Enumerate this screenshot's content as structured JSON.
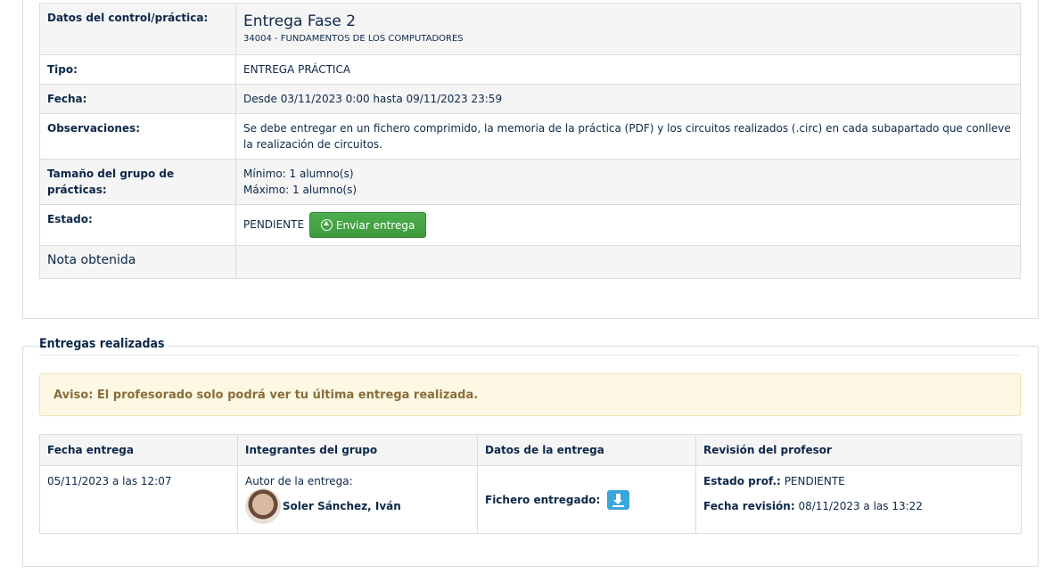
{
  "detail": {
    "control_label": "Datos del control/práctica:",
    "control_title": "Entrega Fase 2",
    "control_course": "34004 - FUNDAMENTOS DE LOS COMPUTADORES",
    "tipo_label": "Tipo:",
    "tipo_value": "ENTREGA PRÁCTICA",
    "fecha_label": "Fecha:",
    "fecha_value": "Desde 03/11/2023 0:00 hasta 09/11/2023 23:59",
    "obs_label": "Observaciones:",
    "obs_value": "Se debe entregar en un fichero comprimido, la memoria de la práctica (PDF) y los circuitos realizados (.circ) en cada subapartado que conlleve la realización de circuitos.",
    "group_label": "Tamaño del grupo de prácticas:",
    "group_min": "Mínimo: 1 alumno(s)",
    "group_max": "Máximo: 1 alumno(s)",
    "estado_label": "Estado:",
    "estado_value": "PENDIENTE",
    "send_button": "Enviar entrega",
    "nota_label": "Nota obtenida",
    "nota_value": ""
  },
  "deliveries": {
    "legend": "Entregas realizadas",
    "alert": "Aviso: El profesorado solo podrá ver tu última entrega realizada.",
    "headers": [
      "Fecha entrega",
      "Integrantes del grupo",
      "Datos de la entrega",
      "Revisión del profesor"
    ],
    "rows": [
      {
        "fecha": "05/11/2023 a las 12:07",
        "autor_label": "Autor de la entrega:",
        "autor_name": "Soler Sánchez, Iván",
        "fichero_label": "Fichero entregado:",
        "estado_prof_label": "Estado prof.:",
        "estado_prof_value": "PENDIENTE",
        "fecha_rev_label": "Fecha revisión:",
        "fecha_rev_value": "08/11/2023 a las 13:22"
      }
    ]
  },
  "colors": {
    "text": "#0c2749",
    "success": "#4cae4c",
    "warning_bg": "#fcf8e3",
    "info": "#3aa7db"
  },
  "icons": {
    "send": "upload-circle-icon",
    "download": "download-icon",
    "avatar": "user-avatar"
  }
}
